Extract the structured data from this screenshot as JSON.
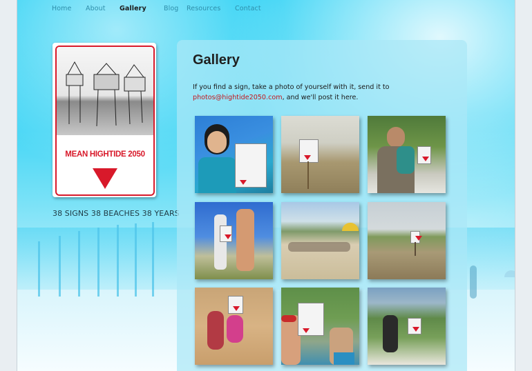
{
  "nav": {
    "items": [
      "Home",
      "About",
      "Gallery",
      "Blog",
      "Resources",
      "Contact"
    ],
    "active": "Gallery"
  },
  "logo": {
    "title": "MEAN HIGHTIDE 2050",
    "tagline": "38 SIGNS 38 BEACHES 38 YEARS"
  },
  "gallery": {
    "heading": "Gallery",
    "intro_before": "If you find a sign, take a photo of yourself with it, send it to",
    "email": "photos@hightide2050.com",
    "intro_after": ", and we'll post it here.",
    "photos": [
      "woman-selfie-with-sign",
      "sign-on-dune",
      "man-holding-baby",
      "couple-posing-with-sign",
      "beach-crowd",
      "sign-at-shoreline",
      "mother-and-child-in-sand",
      "two-boys-with-sign",
      "man-kneeling-by-sign"
    ]
  },
  "colors": {
    "brand_red": "#d8192a",
    "link_blue": "#2e8eaa",
    "sky": "#28d0f4"
  }
}
